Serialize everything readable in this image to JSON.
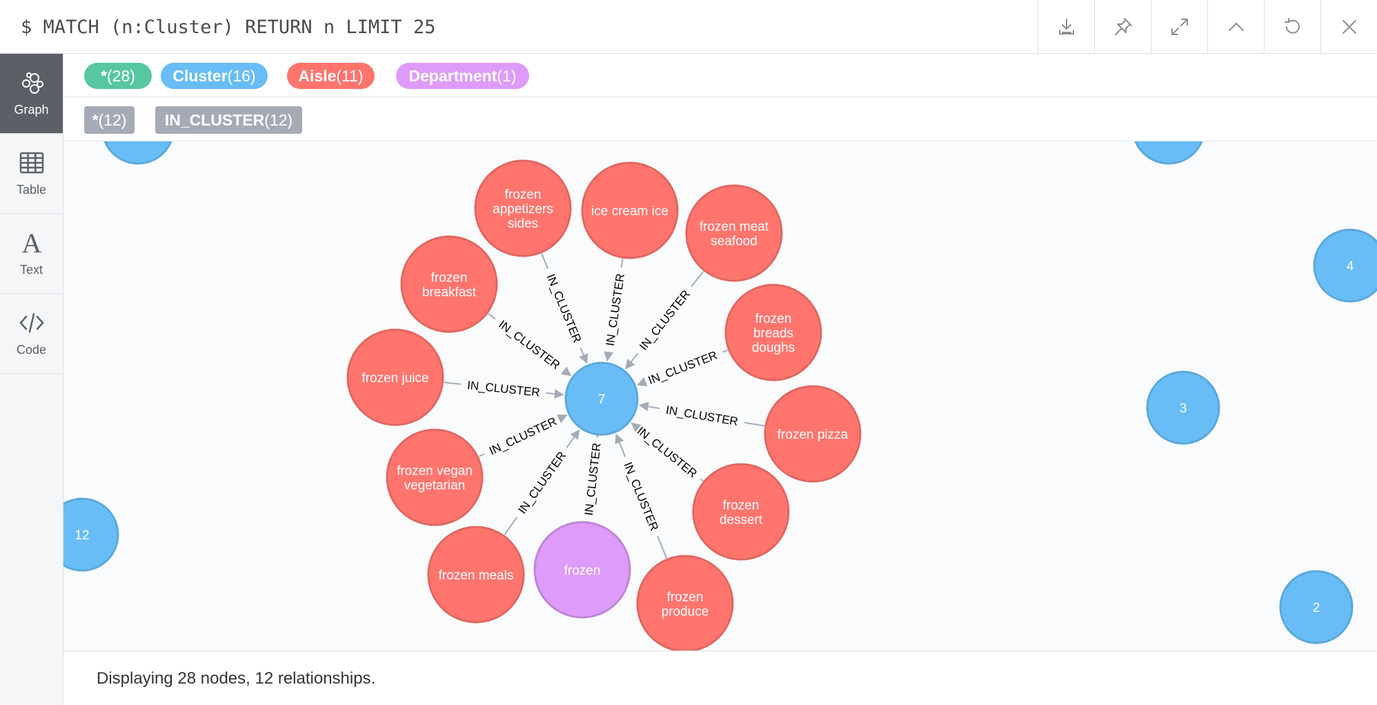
{
  "query": "$ MATCH (n:Cluster) RETURN n LIMIT 25",
  "toolbar": {
    "icons": [
      "download-icon",
      "pin-icon",
      "expand-icon",
      "collapse-icon",
      "refresh-icon",
      "close-icon"
    ]
  },
  "sidebar": {
    "items": [
      {
        "label": "Graph",
        "icon": "graph-icon",
        "active": true
      },
      {
        "label": "Table",
        "icon": "table-icon",
        "active": false
      },
      {
        "label": "Text",
        "icon": "text-icon",
        "active": false
      },
      {
        "label": "Code",
        "icon": "code-icon",
        "active": false
      }
    ]
  },
  "labels": [
    {
      "name": "*",
      "count": "(28)",
      "color": "#57c7a3"
    },
    {
      "name": "Cluster",
      "count": "(16)",
      "color": "#68bdf6"
    },
    {
      "name": "Aisle",
      "count": "(11)",
      "color": "#ff756e"
    },
    {
      "name": "Department",
      "count": "(1)",
      "color": "#de9bf9"
    }
  ],
  "rel_types": [
    {
      "name": "*",
      "count": "(12)"
    },
    {
      "name": "IN_CLUSTER",
      "count": "(12)"
    }
  ],
  "colors": {
    "cluster": "#68bdf6",
    "cluster_border": "#5ca8db",
    "aisle": "#ff756e",
    "aisle_border": "#e06760",
    "department": "#de9bf9",
    "department_border": "#bf85d6",
    "edge": "#a5abb6"
  },
  "graph": {
    "relationship_label": "IN_CLUSTER",
    "center": {
      "label": "7",
      "type": "cluster"
    },
    "aisles": [
      {
        "lines": [
          "frozen",
          "appetizers",
          "sides"
        ],
        "type": "aisle"
      },
      {
        "lines": [
          "ice cream ice"
        ],
        "type": "aisle"
      },
      {
        "lines": [
          "frozen meat",
          "seafood"
        ],
        "type": "aisle"
      },
      {
        "lines": [
          "frozen",
          "breads",
          "doughs"
        ],
        "type": "aisle"
      },
      {
        "lines": [
          "frozen pizza"
        ],
        "type": "aisle"
      },
      {
        "lines": [
          "frozen",
          "dessert"
        ],
        "type": "aisle"
      },
      {
        "lines": [
          "frozen",
          "produce"
        ],
        "type": "aisle"
      },
      {
        "lines": [
          "frozen"
        ],
        "type": "department"
      },
      {
        "lines": [
          "frozen meals"
        ],
        "type": "aisle"
      },
      {
        "lines": [
          "frozen vegan",
          "vegetarian"
        ],
        "type": "aisle"
      },
      {
        "lines": [
          "frozen juice"
        ],
        "type": "aisle"
      },
      {
        "lines": [
          "frozen",
          "breakfast"
        ],
        "type": "aisle"
      }
    ],
    "other_clusters": [
      {
        "label": "4"
      },
      {
        "label": "3"
      },
      {
        "label": "12"
      },
      {
        "label": "2"
      },
      {
        "label": ""
      },
      {
        "label": ""
      }
    ]
  },
  "footer": {
    "status": "Displaying 28 nodes, 12 relationships."
  }
}
